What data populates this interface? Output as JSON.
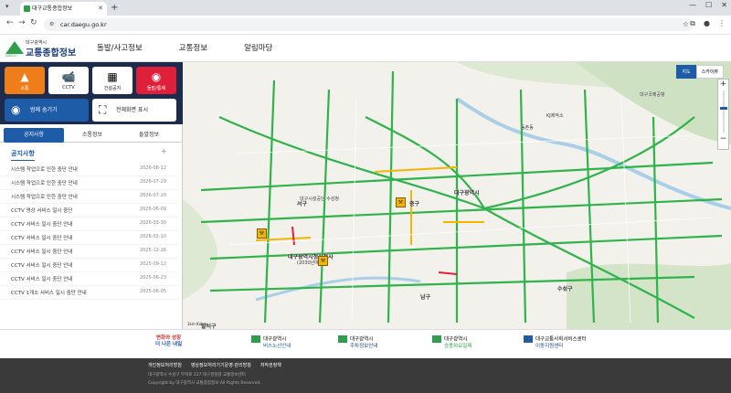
{
  "browser": {
    "tab_title": "대구교통종합정보",
    "url": "car.daegu.go.kr"
  },
  "header": {
    "logo_sub": "대구광역시",
    "logo_title": "교통종합정보",
    "logo_tag": "DAEGU",
    "menu": [
      "돌발/사고정보",
      "교통정보",
      "알림마당"
    ]
  },
  "quick": {
    "accident": "소통",
    "cctv": "CCTV",
    "construction": "건설공지",
    "disaster": "돌발/통제",
    "hide_legend": "범례 숨기기",
    "fullscreen": "전체화면 표시"
  },
  "subtabs": [
    "공지사항",
    "소통정보",
    "돌발정보"
  ],
  "notices": {
    "heading": "공지사항",
    "items": [
      {
        "title": "시스템 작업으로 인한 중단 안내",
        "date": "2026-08-12"
      },
      {
        "title": "시스템 작업으로 인한 중단 안내",
        "date": "2026-07-29"
      },
      {
        "title": "시스템 작업으로 인한 중단 안내",
        "date": "2026-07-20"
      },
      {
        "title": "CCTV 영상 서비스 일시 중단",
        "date": "2026-06-09"
      },
      {
        "title": "CCTV 서비스 일시 중단 안내",
        "date": "2026-03-30"
      },
      {
        "title": "CCTV 서비스 일시 중단 안내",
        "date": "2026-02-10"
      },
      {
        "title": "CCTV 서비스 일시 중단 안내",
        "date": "2025-12-26"
      },
      {
        "title": "CCTV 서비스 일시 중단 안내",
        "date": "2025-09-12"
      },
      {
        "title": "CCTV 서비스 일시 중단 안내",
        "date": "2025-06-23"
      },
      {
        "title": "CCTV 1개소 서비스 일시 중단 안내",
        "date": "2025-06-05"
      }
    ]
  },
  "map": {
    "type_active": "지도",
    "type_other": "스카이뷰",
    "scale": "1km Kakao",
    "labels": {
      "daegu_station": "대구광역시",
      "jung": "중구",
      "nam": "남구",
      "suseong": "수성구",
      "dongchon": "동촌동",
      "new_city_hall": "대구광역시청신청사",
      "city_hall_year": "(2030년예정)",
      "dalseo": "달서구",
      "seo": "서구",
      "kj_tech": "KJ제작소",
      "dalseong_park": "대구시설공단\n수성청",
      "airport": "대구국제공항"
    }
  },
  "banners": {
    "campaign_1": "변화와 성장",
    "campaign_2": "더 나은 내일",
    "bus_1": "대구광역시",
    "bus_2": "버스노선안내",
    "parking_1": "대구광역시",
    "parking_2": "주차정보안내",
    "transfer_1": "대구광역시",
    "transfer_2": "승용차요일제",
    "mobility_1": "대구교통사회서비스센터",
    "mobility_2": "이동지원센터"
  },
  "footer": {
    "links": [
      "개인정보처리방침",
      "영상정보처리기기운영·관리방침",
      "저작권정책"
    ],
    "address": "대구광역시 수성구 무학로 227 대구경찰청 교통정보센터",
    "copyright": "Copyright by 대구광역시 교통종합정보 All Rights Reserved."
  },
  "colors": {
    "navy": "#1d2c4d",
    "accent_blue": "#1e5ca8",
    "accident_orange": "#ee7d1a",
    "disaster_red": "#e0203a",
    "road_green": "#2fb34a",
    "road_yellow": "#f5b400"
  }
}
